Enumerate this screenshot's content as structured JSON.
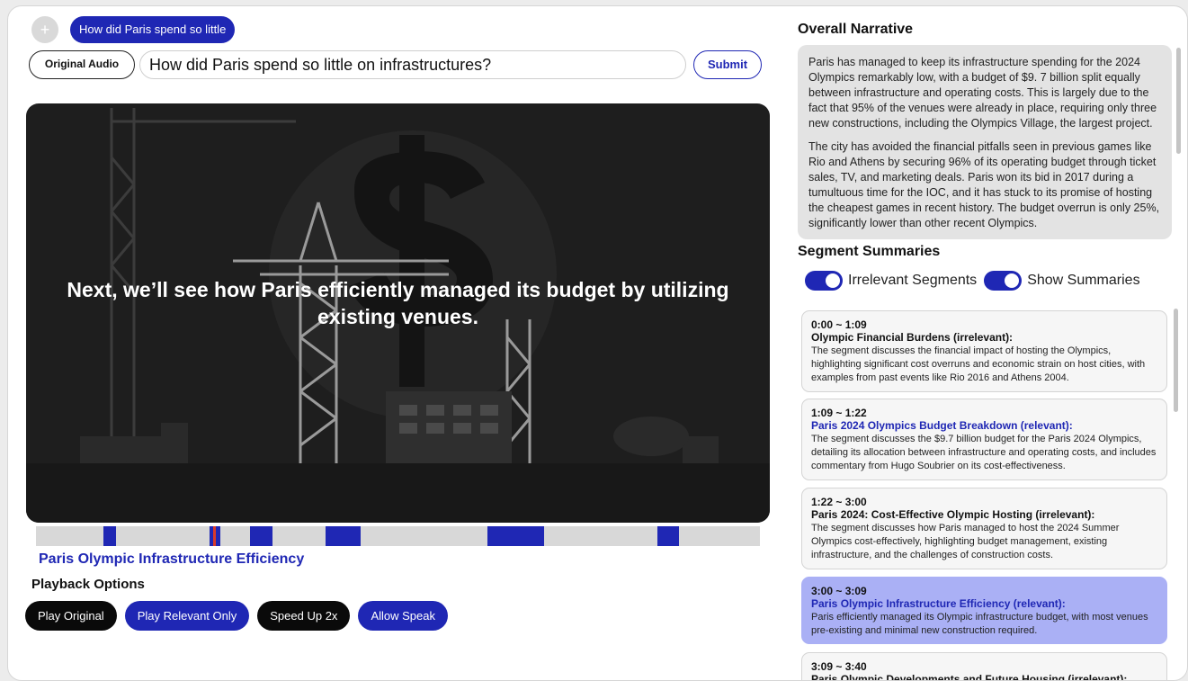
{
  "top_bar": {
    "add_icon": "plus-icon",
    "query_chip": "How did Paris spend so little",
    "original_audio_label": "Original Audio",
    "query_value": "How did Paris spend so little on infrastructures?",
    "submit_label": "Submit"
  },
  "video": {
    "caption": "Next, we’ll see how Paris efficiently managed its budget by utilizing existing venues.",
    "timeline": {
      "playhead_position": 0.245,
      "relevant_segments": [
        {
          "start": 0.093,
          "end": 0.11
        },
        {
          "start": 0.24,
          "end": 0.255
        },
        {
          "start": 0.296,
          "end": 0.327
        },
        {
          "start": 0.4,
          "end": 0.449
        },
        {
          "start": 0.623,
          "end": 0.702
        },
        {
          "start": 0.859,
          "end": 0.888
        }
      ]
    },
    "current_segment_title": "Paris Olympic Infrastructure Efficiency"
  },
  "playback": {
    "heading": "Playback Options",
    "buttons": [
      {
        "label": "Play Original",
        "style": "dark"
      },
      {
        "label": "Play Relevant Only",
        "style": "blue"
      },
      {
        "label": "Speed Up 2x",
        "style": "dark"
      },
      {
        "label": "Allow Speak",
        "style": "blue"
      }
    ]
  },
  "narrative": {
    "heading": "Overall Narrative",
    "paragraphs": [
      "Paris has managed to keep its infrastructure spending for the 2024 Olympics remarkably low, with a budget of $9. 7 billion split equally between infrastructure and operating costs. This is largely due to the fact that 95% of the venues were already in place, requiring only three new constructions, including the Olympics Village, the largest project.",
      "The city has avoided the financial pitfalls seen in previous games like Rio and Athens by securing 96% of its operating budget through ticket sales, TV, and marketing deals. Paris won its bid in 2017 during a tumultuous time for the IOC, and it has stuck to its promise of hosting the cheapest games in recent history. The budget overrun is only 25%, significantly lower than other recent Olympics."
    ]
  },
  "segments": {
    "heading": "Segment Summaries",
    "toggles": [
      {
        "label": "Irrelevant Segments",
        "on": true
      },
      {
        "label": "Show Summaries",
        "on": true
      }
    ],
    "items": [
      {
        "time": "0:00 ~ 1:09",
        "title": "Olympic Financial Burdens (irrelevant):",
        "relevant": false,
        "active": false,
        "desc": "The segment discusses the financial impact of hosting the Olympics, highlighting significant cost overruns and economic strain on host cities, with examples from past events like Rio 2016 and Athens 2004."
      },
      {
        "time": "1:09 ~ 1:22",
        "title": "Paris 2024 Olympics Budget Breakdown (relevant):",
        "relevant": true,
        "active": false,
        "desc": "The segment discusses the $9.7 billion budget for the Paris 2024 Olympics, detailing its allocation between infrastructure and operating costs, and includes commentary from Hugo Soubrier on its cost-effectiveness."
      },
      {
        "time": "1:22 ~ 3:00",
        "title": "Paris 2024: Cost-Effective Olympic Hosting (irrelevant):",
        "relevant": false,
        "active": false,
        "desc": "The segment discusses how Paris managed to host the 2024 Summer Olympics cost-effectively, highlighting budget management, existing infrastructure, and the challenges of construction costs."
      },
      {
        "time": "3:00 ~ 3:09",
        "title": "Paris Olympic Infrastructure Efficiency (relevant):",
        "relevant": true,
        "active": true,
        "desc": "Paris efficiently managed its Olympic infrastructure budget, with most venues pre-existing and minimal new construction required."
      },
      {
        "time": "3:09 ~ 3:40",
        "title": "Paris Olympic Developments and Future Housing (irrelevant):",
        "relevant": false,
        "active": false,
        "desc": ""
      }
    ]
  }
}
